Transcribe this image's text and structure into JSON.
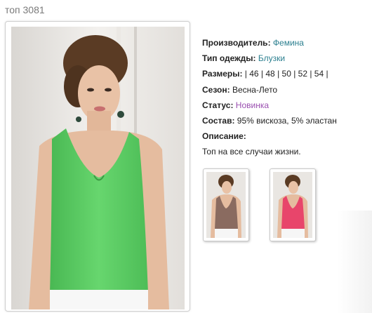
{
  "product": {
    "title": "топ 3081"
  },
  "details": {
    "manufacturer_label": "Производитель:",
    "manufacturer_value": "Фемина",
    "type_label": "Тип одежды:",
    "type_value": "Блузки",
    "sizes_label": "Размеры:",
    "sizes_text": " | 46 | 48 | 50 | 52 | 54 |",
    "season_label": "Сезон:",
    "season_value": "Весна-Лето",
    "status_label": "Статус:",
    "status_value": "Новинка",
    "composition_label": "Состав:",
    "composition_value": "95% вискоза, 5% эластан",
    "description_label": "Описание:",
    "description_value": "Топ на все случаи жизни."
  },
  "thumbnails": [
    {
      "color_name": "brown-top",
      "top_color": "#8a6b60"
    },
    {
      "color_name": "pink-top",
      "top_color": "#e8456b"
    }
  ],
  "colors": {
    "link_teal": "#2b7f8f",
    "link_purple": "#9a4fb0",
    "main_top": "#5fd067"
  }
}
